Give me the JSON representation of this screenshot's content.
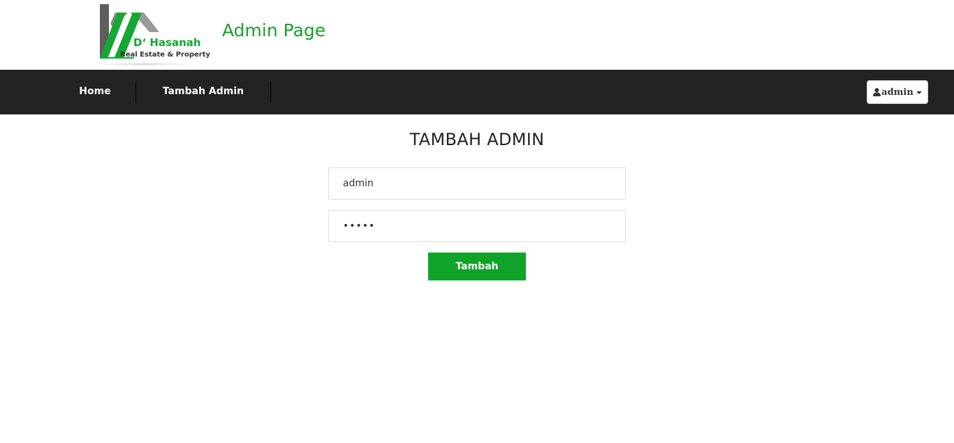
{
  "header": {
    "logo": {
      "brand_text": "D‘ Hasanah",
      "tagline": "Real Estate & Property",
      "colors": {
        "green": "#15a832",
        "gray": "#6b6b6b",
        "dark": "#333333"
      }
    },
    "title": "Admin Page",
    "title_color": "#1a9e2b"
  },
  "nav": {
    "background": "#232323",
    "items": [
      {
        "label": "Home"
      },
      {
        "label": "Tambah Admin"
      }
    ],
    "user_menu": {
      "icon": "user-icon",
      "label": "admin"
    }
  },
  "form": {
    "heading": "TAMBAH ADMIN",
    "username_value": "admin",
    "password_value": "admin",
    "submit_label": "Tambah",
    "submit_color": "#0fa32a"
  }
}
